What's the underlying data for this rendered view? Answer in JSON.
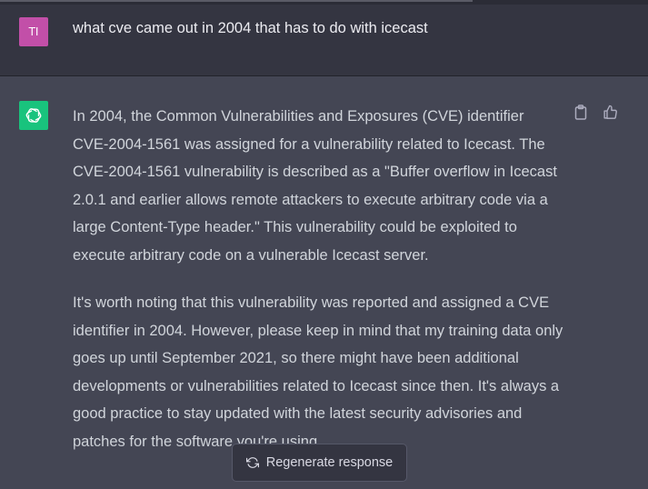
{
  "user": {
    "avatar_initials": "TI",
    "avatar_color": "#c24fa8",
    "message": "what cve came out in 2004 that has to do with icecast"
  },
  "assistant": {
    "avatar_icon": "openai-logo-icon",
    "avatar_color": "#19c37d",
    "paragraphs": [
      "In 2004, the Common Vulnerabilities and Exposures (CVE) identifier CVE-2004-1561 was assigned for a vulnerability related to Icecast. The CVE-2004-1561 vulnerability is described as a \"Buffer overflow in Icecast 2.0.1 and earlier allows remote attackers to execute arbitrary code via a large Content-Type header.\" This vulnerability could be exploited to execute arbitrary code on a vulnerable Icecast server.",
      "It's worth noting that this vulnerability was reported and assigned a CVE identifier in 2004. However, please keep in mind that my training data only goes up until September 2021, so there might have been additional developments or vulnerabilities related to Icecast since then. It's always a good practice to stay updated with the latest security advisories and patches for the software you're using."
    ],
    "actions": [
      "clipboard-icon",
      "thumbs-up-icon"
    ]
  },
  "regenerate": {
    "label": "Regenerate response",
    "icon": "refresh-icon"
  }
}
